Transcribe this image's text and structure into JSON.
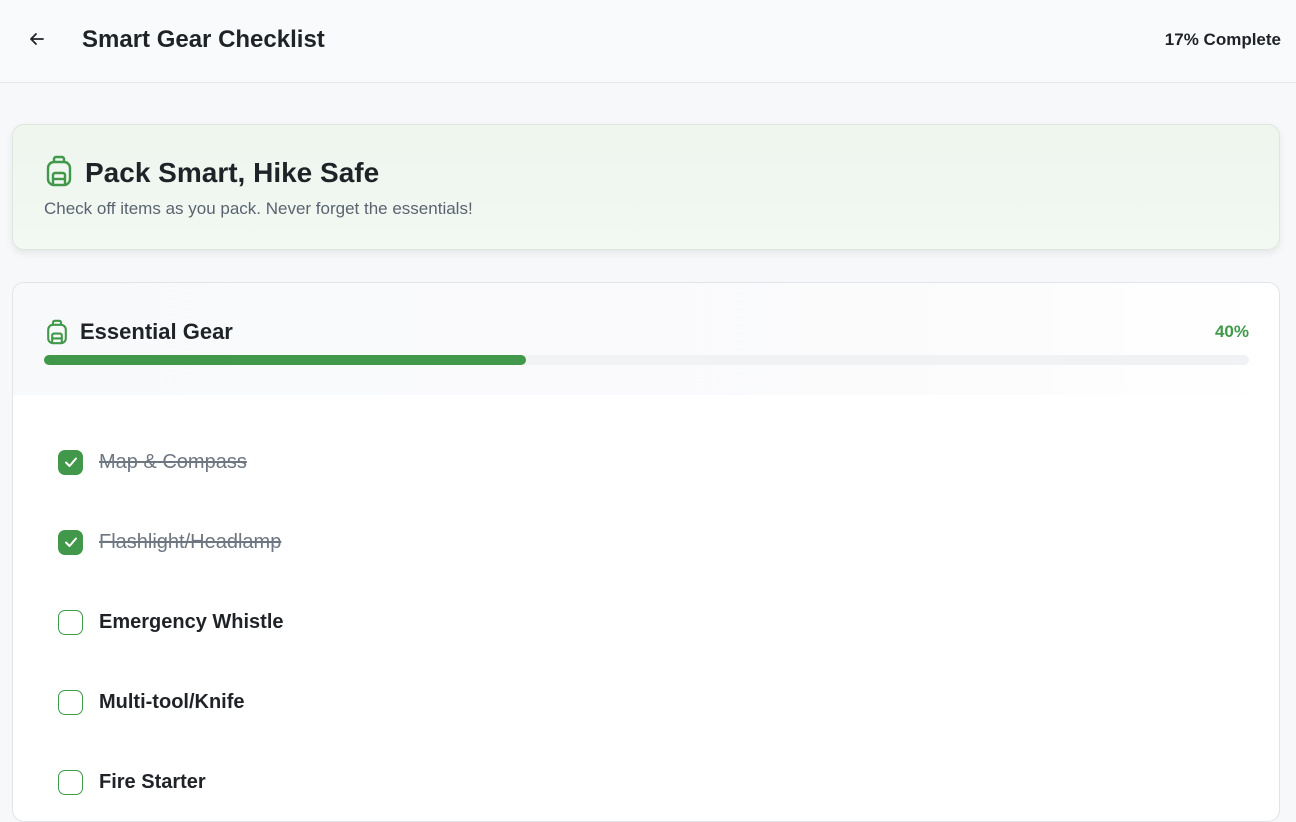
{
  "header": {
    "title": "Smart Gear Checklist",
    "progress_text": "17% Complete",
    "back_icon": "arrow-left-icon"
  },
  "banner": {
    "icon": "backpack-icon",
    "title": "Pack Smart, Hike Safe",
    "subtitle": "Check off items as you pack. Never forget the essentials!"
  },
  "section": {
    "icon": "backpack-icon",
    "title": "Essential Gear",
    "percent_label": "40%",
    "progress": 0.4,
    "items": [
      {
        "label": "Map & Compass",
        "checked": true
      },
      {
        "label": "Flashlight/Headlamp",
        "checked": true
      },
      {
        "label": "Emergency Whistle",
        "checked": false
      },
      {
        "label": "Multi-tool/Knife",
        "checked": false
      },
      {
        "label": "Fire Starter",
        "checked": false
      }
    ]
  },
  "colors": {
    "accent": "#41984a",
    "accent_text": "#3f9a4a",
    "banner_bg": "#eef6ee"
  }
}
